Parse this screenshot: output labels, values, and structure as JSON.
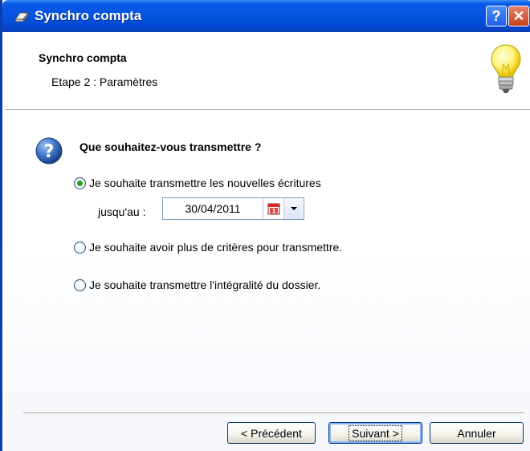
{
  "window": {
    "title": "Synchro compta",
    "help_label": "?",
    "close_label": "✕",
    "app_icon": "synchro-icon"
  },
  "header": {
    "title": "Synchro compta",
    "subtitle": "Etape 2 : Paramètres",
    "icon": "lightbulb-icon"
  },
  "main": {
    "question": "Que souhaitez-vous transmettre ?",
    "question_icon": "help-icon",
    "options": [
      {
        "label": "Je souhaite transmettre les nouvelles écritures",
        "checked": true
      },
      {
        "label": "Je souhaite avoir plus de critères pour transmettre.",
        "checked": false
      },
      {
        "label": "Je souhaite transmettre l'intégralité du dossier.",
        "checked": false
      }
    ],
    "until_label": "jusqu'au :",
    "date_value": "30/04/2011",
    "calendar_icon": "calendar-icon",
    "dropdown_icon": "chevron-down-icon"
  },
  "footer": {
    "prev_label": "< Précédent",
    "next_label": "Suivant >",
    "cancel_label": "Annuler"
  },
  "colors": {
    "titlebar": "#0554e0",
    "radio_dot": "#21a121",
    "button_border": "#003c74"
  }
}
